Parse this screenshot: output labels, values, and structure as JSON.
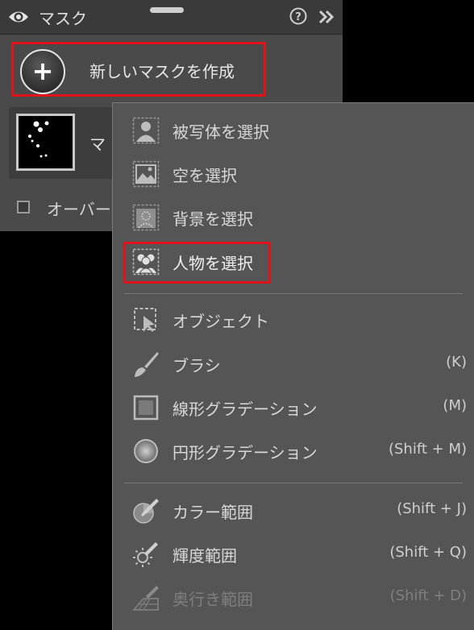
{
  "header": {
    "title": "マスク",
    "help_icon": "help-circle-icon",
    "collapse_icon": "double-chevron-right-icon"
  },
  "new_mask": {
    "label": "新しいマスクを作成",
    "plus": "+"
  },
  "mask_item": {
    "name": "マ"
  },
  "overlay": {
    "label": "オーバー"
  },
  "menu": {
    "items": [
      {
        "label": "被写体を選択",
        "shortcut": ""
      },
      {
        "label": "空を選択",
        "shortcut": ""
      },
      {
        "label": "背景を選択",
        "shortcut": ""
      },
      {
        "label": "人物を選択",
        "shortcut": ""
      },
      {
        "label": "オブジェクト",
        "shortcut": ""
      },
      {
        "label": "ブラシ",
        "shortcut": "(K)"
      },
      {
        "label": "線形グラデーション",
        "shortcut": "(M)"
      },
      {
        "label": "円形グラデーション",
        "shortcut": "(Shift + M)"
      },
      {
        "label": "カラー範囲",
        "shortcut": "(Shift + J)"
      },
      {
        "label": "輝度範囲",
        "shortcut": "(Shift + Q)"
      },
      {
        "label": "奥行き範囲",
        "shortcut": "(Shift + D)"
      }
    ]
  },
  "colors": {
    "highlight_border": "#e0121a",
    "panel_bg": "#4a4a4a",
    "menu_bg": "#555555"
  }
}
